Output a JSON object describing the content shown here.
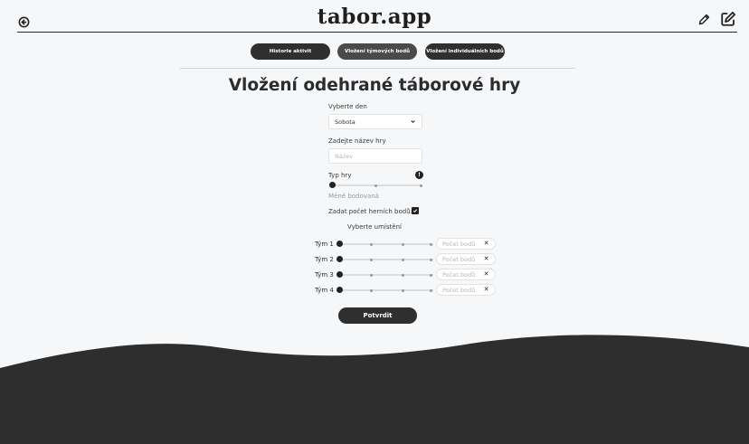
{
  "app": {
    "logo": "tabor.app"
  },
  "header": {
    "icons": [
      "back-arrow-icon",
      "pencil-icon",
      "edit-square-icon"
    ]
  },
  "nav": {
    "tabs": [
      {
        "label": "Historie aktivit",
        "active": false
      },
      {
        "label": "Vložení týmových bodů",
        "active": true
      },
      {
        "label": "Vložení individuálních bodů",
        "active": false
      }
    ]
  },
  "page": {
    "title": "Vložení odehrané táborové hry"
  },
  "form": {
    "day_label": "Vyberte den",
    "day_value": "Sobota",
    "name_label": "Zadejte název hry",
    "name_placeholder": "Název",
    "type_label": "Typ hry",
    "type_info": "!",
    "type_value": "Méně bodovaná",
    "type_level": 0,
    "points_checkbox_label": "Zadat počet herních bodů:",
    "points_checkbox_checked": true,
    "placement_label": "Vyberte umístění",
    "teams": [
      {
        "name": "Tým 1",
        "placeholder": "Počet bodů",
        "clear": "✕",
        "level": 0
      },
      {
        "name": "Tým 2",
        "placeholder": "Počet bodů",
        "clear": "✕",
        "level": 0
      },
      {
        "name": "Tým 3",
        "placeholder": "Počet bodů",
        "clear": "✕",
        "level": 0
      },
      {
        "name": "Tým 4",
        "placeholder": "Počet bodů",
        "clear": "✕",
        "level": 0
      }
    ],
    "submit_label": "Potvrdit"
  },
  "colors": {
    "primary": "#2f2f2f",
    "background": "#f6f7f9",
    "footer": "#2e2e2e"
  }
}
